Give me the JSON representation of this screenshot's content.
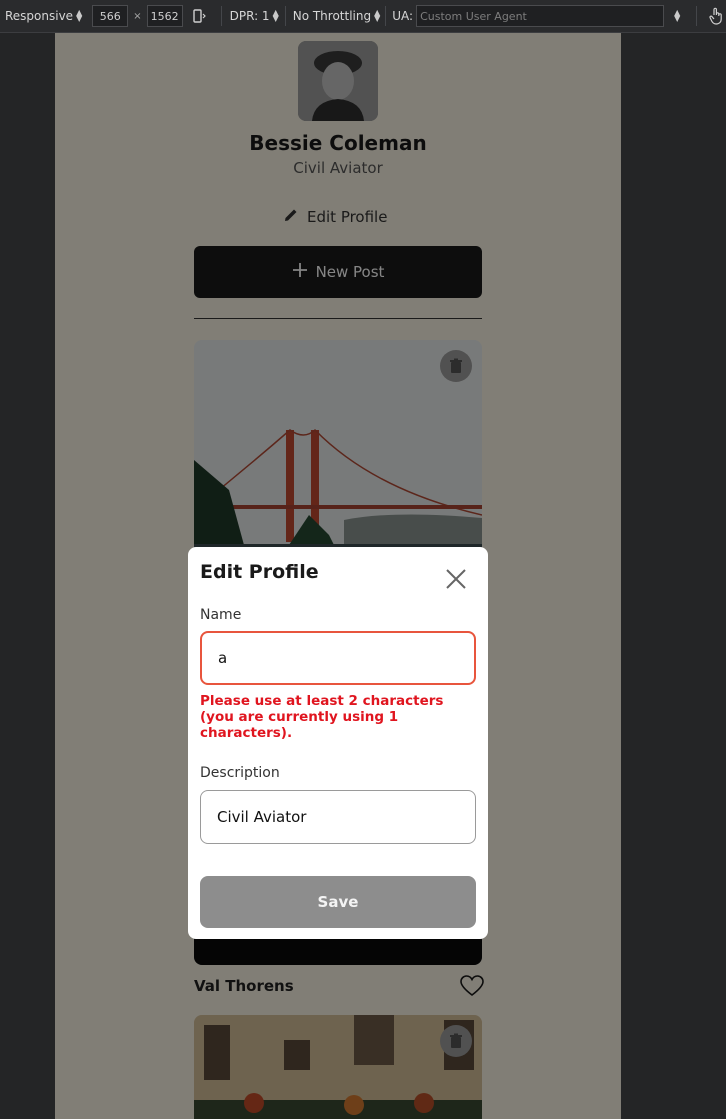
{
  "devtools": {
    "device_mode": "Responsive",
    "width": "566",
    "times": "×",
    "height": "1562",
    "dpr": "DPR: 1",
    "throttling": "No Throttling",
    "ua_label": "UA:",
    "ua_placeholder": "Custom User Agent"
  },
  "profile": {
    "name": "Bessie Coleman",
    "description": "Civil Aviator",
    "edit_label": "Edit Profile",
    "new_post_label": "New Post"
  },
  "cards": [
    {
      "title": "Val Thorens",
      "liked": false
    }
  ],
  "modal": {
    "title": "Edit Profile",
    "name_label": "Name",
    "name_value": "a",
    "error_message": "Please use at least 2 characters (you are currently using 1 characters).",
    "description_label": "Description",
    "description_value": "Civil Aviator",
    "save_label": "Save"
  },
  "colors": {
    "page_background": "#f8f2e2",
    "primary_button": "#1a1a1a",
    "error": "#e0151f",
    "error_border": "#e8553d",
    "disabled_button": "#8d8d8d"
  },
  "icons": [
    "pencil-icon",
    "plus-icon",
    "trash-icon",
    "heart-icon",
    "close-icon",
    "touch-icon",
    "rotate-icon"
  ]
}
